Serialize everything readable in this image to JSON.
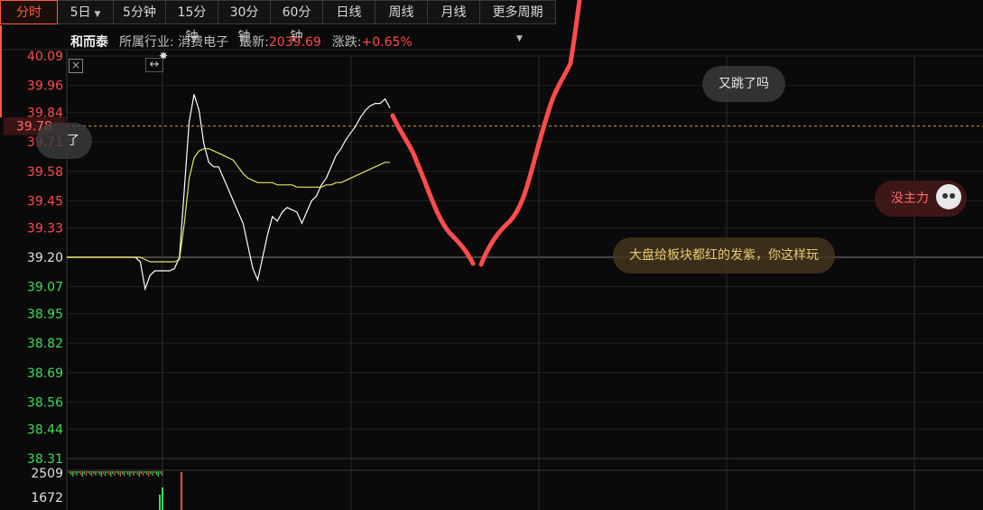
{
  "tabs": [
    {
      "label": "分时",
      "active": true
    },
    {
      "label": "5日",
      "dropdown": true
    },
    {
      "label": "5分钟"
    },
    {
      "label": "15分钟"
    },
    {
      "label": "30分钟"
    },
    {
      "label": "60分钟"
    },
    {
      "label": "日线"
    },
    {
      "label": "周线"
    },
    {
      "label": "月线"
    },
    {
      "label": "更多周期",
      "dropdown": true
    }
  ],
  "info": {
    "name": "和而泰",
    "industry_label": "所属行业:",
    "industry": "消费电子",
    "latest_label": "最新:",
    "latest": "2039.69",
    "change_label": "涨跌:",
    "change": "+0.65%"
  },
  "price_axis": {
    "up_labels": [
      "40.09",
      "39.96",
      "39.84",
      "39.71",
      "39.58",
      "39.45",
      "39.33"
    ],
    "base_label": "39.20",
    "down_labels": [
      "39.07",
      "38.95",
      "38.82",
      "38.69",
      "38.56",
      "38.44",
      "38.31"
    ],
    "current_marker": "39.78"
  },
  "volume_axis": {
    "labels": [
      "2509",
      "1672"
    ]
  },
  "bubbles": {
    "left_partial": "了",
    "b1": "又跳了吗",
    "b2": "没主力",
    "b3": "大盘给板块都红的发紫，你这样玩"
  },
  "icons": {
    "close": "close-icon",
    "resize": "resize-arrows-icon",
    "gear": "gear-icon"
  },
  "colors": {
    "up": "#ff4a4a",
    "down": "#3ddc5a",
    "price_line": "#ffffff",
    "avg_line": "#e6e663",
    "annotation": "#ff4b4b"
  },
  "chart_data": {
    "type": "line",
    "title": "",
    "xlabel": "",
    "ylabel": "",
    "ylim": [
      38.31,
      40.09
    ],
    "series": [
      {
        "name": "",
        "values": [
          39.2,
          39.2,
          39.2,
          39.2,
          39.2,
          39.2,
          39.2,
          39.2,
          39.2,
          39.2,
          39.2,
          39.2,
          39.2,
          39.2,
          39.2,
          39.18,
          39.06,
          39.12,
          39.14,
          39.14,
          39.14,
          39.14,
          39.15,
          39.2,
          39.5,
          39.8,
          39.92,
          39.85,
          39.7,
          39.62,
          39.6,
          39.6,
          39.55,
          39.5,
          39.45,
          39.4,
          39.35,
          39.25,
          39.15,
          39.1,
          39.2,
          39.3,
          39.38,
          39.36,
          39.4,
          39.42,
          39.41,
          39.4,
          39.35,
          39.4,
          39.45,
          39.47,
          39.52,
          39.55,
          39.6,
          39.65,
          39.68,
          39.72,
          39.75,
          39.78,
          39.82,
          39.85,
          39.87,
          39.88,
          39.88,
          39.9,
          39.86
        ]
      },
      {
        "name": "",
        "values": [
          39.2,
          39.2,
          39.2,
          39.2,
          39.2,
          39.2,
          39.2,
          39.2,
          39.2,
          39.2,
          39.2,
          39.2,
          39.2,
          39.2,
          39.2,
          39.2,
          39.19,
          39.18,
          39.18,
          39.18,
          39.18,
          39.18,
          39.18,
          39.19,
          39.35,
          39.55,
          39.64,
          39.67,
          39.68,
          39.68,
          39.67,
          39.66,
          39.65,
          39.64,
          39.63,
          39.6,
          39.57,
          39.55,
          39.54,
          39.53,
          39.53,
          39.53,
          39.53,
          39.52,
          39.52,
          39.52,
          39.52,
          39.51,
          39.51,
          39.51,
          39.51,
          39.51,
          39.51,
          39.52,
          39.52,
          39.53,
          39.53,
          39.54,
          39.55,
          39.56,
          39.57,
          39.58,
          39.59,
          39.6,
          39.61,
          39.62,
          39.62
        ]
      }
    ]
  }
}
